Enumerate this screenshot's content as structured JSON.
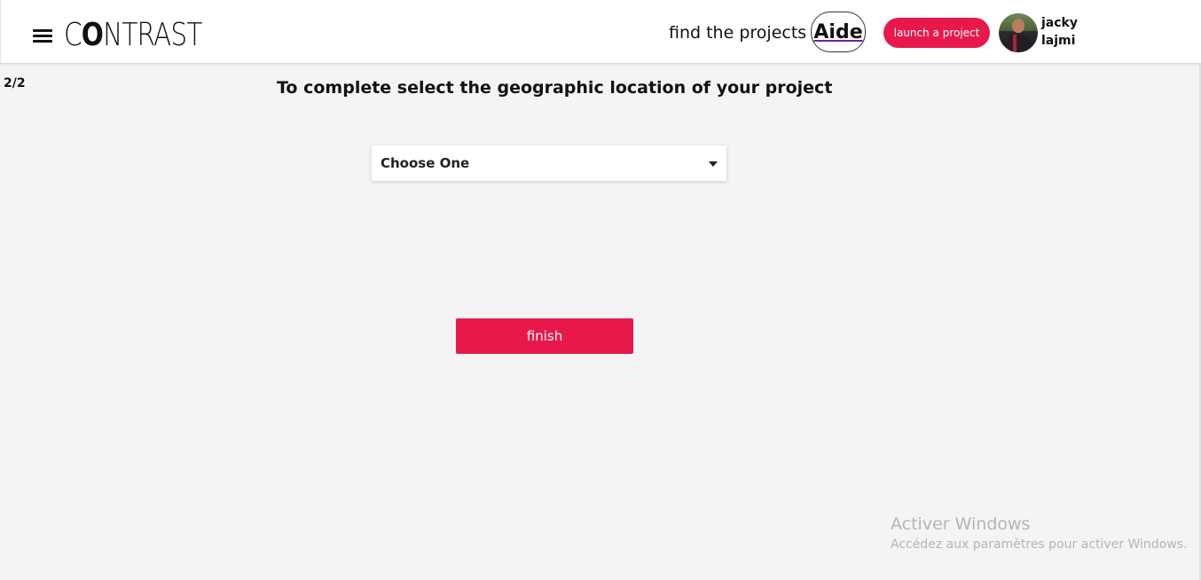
{
  "header": {
    "logo_text_1": "C",
    "logo_text_2": "O",
    "logo_text_3": "NTRAST",
    "find_projects": "find the projects",
    "aide": "Aide",
    "launch": "launch a project",
    "user_first": "jacky",
    "user_last": "lajmi"
  },
  "main": {
    "step": "2/2",
    "title": "To complete select the geographic location of your project",
    "select_value": "Choose One",
    "finish": "finish"
  },
  "watermark": {
    "title": "Activer Windows",
    "subtitle": "Accédez aux paramètres pour activer Windows."
  },
  "colors": {
    "accent": "#e8194a",
    "background": "#f4f4f4"
  }
}
